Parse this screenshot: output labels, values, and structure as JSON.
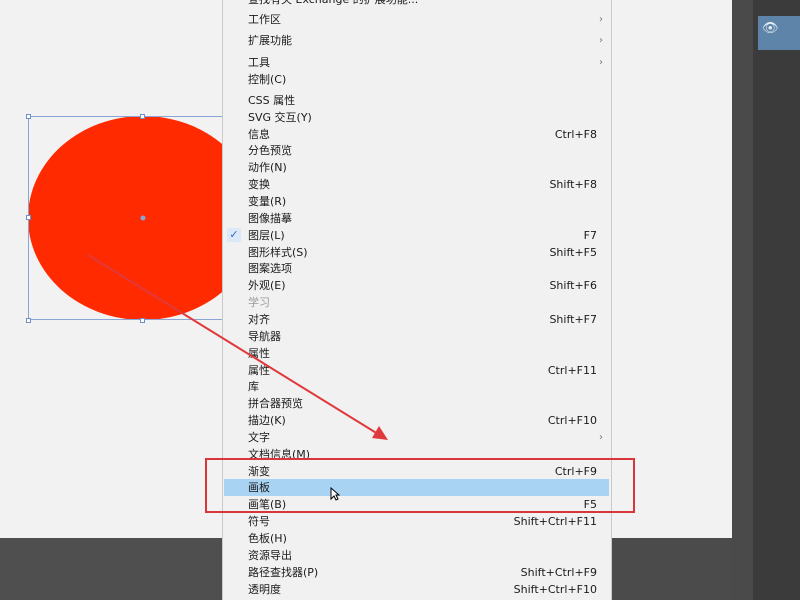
{
  "menu": {
    "items": [
      {
        "label": "查找有关 Exchange 的扩展功能...",
        "shortcut": "",
        "submenu": false,
        "checked": false,
        "disabled": false,
        "highlighted": false,
        "cut": true
      },
      {
        "label": "工作区",
        "shortcut": "",
        "submenu": true,
        "checked": false,
        "disabled": false,
        "highlighted": false
      },
      {
        "label": "",
        "spacer": true
      },
      {
        "label": "扩展功能",
        "shortcut": "",
        "submenu": true,
        "checked": false,
        "disabled": false,
        "highlighted": false
      },
      {
        "label": "",
        "spacer": true
      },
      {
        "label": "工具",
        "shortcut": "",
        "submenu": true,
        "checked": false,
        "disabled": false,
        "highlighted": false
      },
      {
        "label": "控制(C)",
        "shortcut": "",
        "submenu": false,
        "checked": false,
        "disabled": false,
        "highlighted": false
      },
      {
        "label": "",
        "spacer": true
      },
      {
        "label": "CSS 属性",
        "shortcut": "",
        "submenu": false,
        "checked": false,
        "disabled": false,
        "highlighted": false
      },
      {
        "label": "SVG 交互(Y)",
        "shortcut": "",
        "submenu": false,
        "checked": false,
        "disabled": false,
        "highlighted": false
      },
      {
        "label": "信息",
        "shortcut": "Ctrl+F8",
        "submenu": false,
        "checked": false,
        "disabled": false,
        "highlighted": false
      },
      {
        "label": "分色预览",
        "shortcut": "",
        "submenu": false,
        "checked": false,
        "disabled": false,
        "highlighted": false
      },
      {
        "label": "动作(N)",
        "shortcut": "",
        "submenu": false,
        "checked": false,
        "disabled": false,
        "highlighted": false
      },
      {
        "label": "变换",
        "shortcut": "Shift+F8",
        "submenu": false,
        "checked": false,
        "disabled": false,
        "highlighted": false
      },
      {
        "label": "变量(R)",
        "shortcut": "",
        "submenu": false,
        "checked": false,
        "disabled": false,
        "highlighted": false
      },
      {
        "label": "图像描摹",
        "shortcut": "",
        "submenu": false,
        "checked": false,
        "disabled": false,
        "highlighted": false
      },
      {
        "label": "图层(L)",
        "shortcut": "F7",
        "submenu": false,
        "checked": true,
        "disabled": false,
        "highlighted": false
      },
      {
        "label": "图形样式(S)",
        "shortcut": "Shift+F5",
        "submenu": false,
        "checked": false,
        "disabled": false,
        "highlighted": false
      },
      {
        "label": "图案选项",
        "shortcut": "",
        "submenu": false,
        "checked": false,
        "disabled": false,
        "highlighted": false
      },
      {
        "label": "外观(E)",
        "shortcut": "Shift+F6",
        "submenu": false,
        "checked": false,
        "disabled": false,
        "highlighted": false
      },
      {
        "label": "学习",
        "shortcut": "",
        "submenu": false,
        "checked": false,
        "disabled": true,
        "highlighted": false
      },
      {
        "label": "对齐",
        "shortcut": "Shift+F7",
        "submenu": false,
        "checked": false,
        "disabled": false,
        "highlighted": false
      },
      {
        "label": "导航器",
        "shortcut": "",
        "submenu": false,
        "checked": false,
        "disabled": false,
        "highlighted": false
      },
      {
        "label": "属性",
        "shortcut": "",
        "submenu": false,
        "checked": false,
        "disabled": false,
        "highlighted": false
      },
      {
        "label": "属性",
        "shortcut": "Ctrl+F11",
        "submenu": false,
        "checked": false,
        "disabled": false,
        "highlighted": false
      },
      {
        "label": "库",
        "shortcut": "",
        "submenu": false,
        "checked": false,
        "disabled": false,
        "highlighted": false
      },
      {
        "label": "拼合器预览",
        "shortcut": "",
        "submenu": false,
        "checked": false,
        "disabled": false,
        "highlighted": false
      },
      {
        "label": "描边(K)",
        "shortcut": "Ctrl+F10",
        "submenu": false,
        "checked": false,
        "disabled": false,
        "highlighted": false
      },
      {
        "label": "文字",
        "shortcut": "",
        "submenu": true,
        "checked": false,
        "disabled": false,
        "highlighted": false
      },
      {
        "label": "文档信息(M)",
        "shortcut": "",
        "submenu": false,
        "checked": false,
        "disabled": false,
        "highlighted": false
      },
      {
        "label": "渐变",
        "shortcut": "Ctrl+F9",
        "submenu": false,
        "checked": false,
        "disabled": false,
        "highlighted": false
      },
      {
        "label": "画板",
        "shortcut": "",
        "submenu": false,
        "checked": false,
        "disabled": false,
        "highlighted": true
      },
      {
        "label": "画笔(B)",
        "shortcut": "F5",
        "submenu": false,
        "checked": false,
        "disabled": false,
        "highlighted": false
      },
      {
        "label": "符号",
        "shortcut": "Shift+Ctrl+F11",
        "submenu": false,
        "checked": false,
        "disabled": false,
        "highlighted": false
      },
      {
        "label": "色板(H)",
        "shortcut": "",
        "submenu": false,
        "checked": false,
        "disabled": false,
        "highlighted": false
      },
      {
        "label": "资源导出",
        "shortcut": "",
        "submenu": false,
        "checked": false,
        "disabled": false,
        "highlighted": false
      },
      {
        "label": "路径查找器(P)",
        "shortcut": "Shift+Ctrl+F9",
        "submenu": false,
        "checked": false,
        "disabled": false,
        "highlighted": false
      },
      {
        "label": "透明度",
        "shortcut": "Shift+Ctrl+F10",
        "submenu": false,
        "checked": false,
        "disabled": false,
        "highlighted": false
      }
    ]
  },
  "canvas": {
    "circle_color": "#ff2a00",
    "selection_color": "#8aa6d6"
  },
  "annotation": {
    "arrow_color": "#e0393b",
    "box_color": "#d9363b"
  },
  "layers_panel": {
    "eye_icon": "eye-icon"
  }
}
